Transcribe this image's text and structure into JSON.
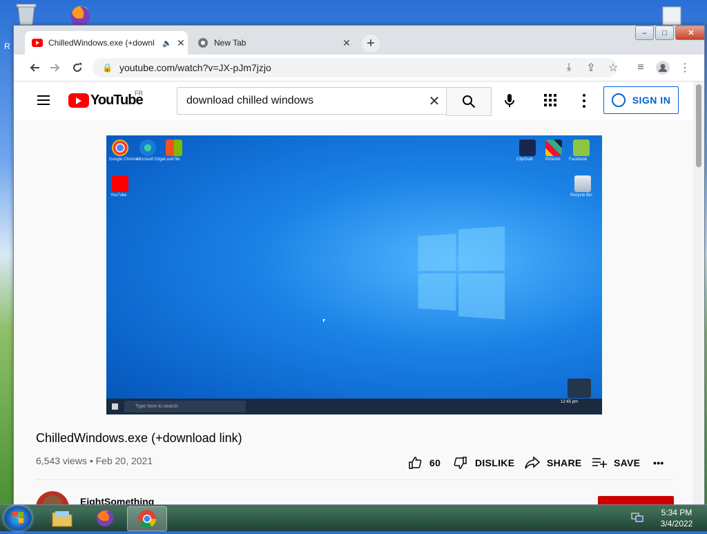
{
  "desktop": {
    "left_edge_letter": "R"
  },
  "chrome": {
    "tabs": [
      {
        "title": "ChilledWindows.exe (+downl",
        "active": true,
        "favicon": "youtube-icon"
      },
      {
        "title": "New Tab",
        "active": false,
        "favicon": "chrome-icon"
      }
    ],
    "window_controls": {
      "minimize": "–",
      "maximize": "□",
      "close": "✕"
    },
    "url": "youtube.com/watch?v=JX-pJm7jzjo"
  },
  "youtube": {
    "logo_text": "YouTube",
    "region": "FR",
    "search_query": "download chilled windows",
    "signin_label": "SIGN IN",
    "video": {
      "title": "ChilledWindows.exe (+download link)",
      "views": "6,543 views • Feb 20, 2021",
      "like_count": "60",
      "dislike_label": "DISLIKE",
      "share_label": "SHARE",
      "save_label": "SAVE",
      "more_label": "•••"
    },
    "embedded_desktop": {
      "search_placeholder": "Type here to search",
      "icon_labels": [
        "Google Chrome",
        "Microsoft Edge",
        "Loud file",
        "YouTube",
        "ClipGrab",
        "Pictures",
        "Facebook",
        "Recycle Bin"
      ],
      "clock": "12:45 pm"
    },
    "channel": {
      "name": "EightSomething"
    }
  },
  "taskbar": {
    "time": "5:34 PM",
    "date": "3/4/2022",
    "items": [
      "explorer-icon",
      "firefox-icon",
      "chrome-icon"
    ]
  },
  "colors": {
    "youtube_red": "#ff0000",
    "link_blue": "#065fd4",
    "subscribe_red": "#cc0000"
  }
}
